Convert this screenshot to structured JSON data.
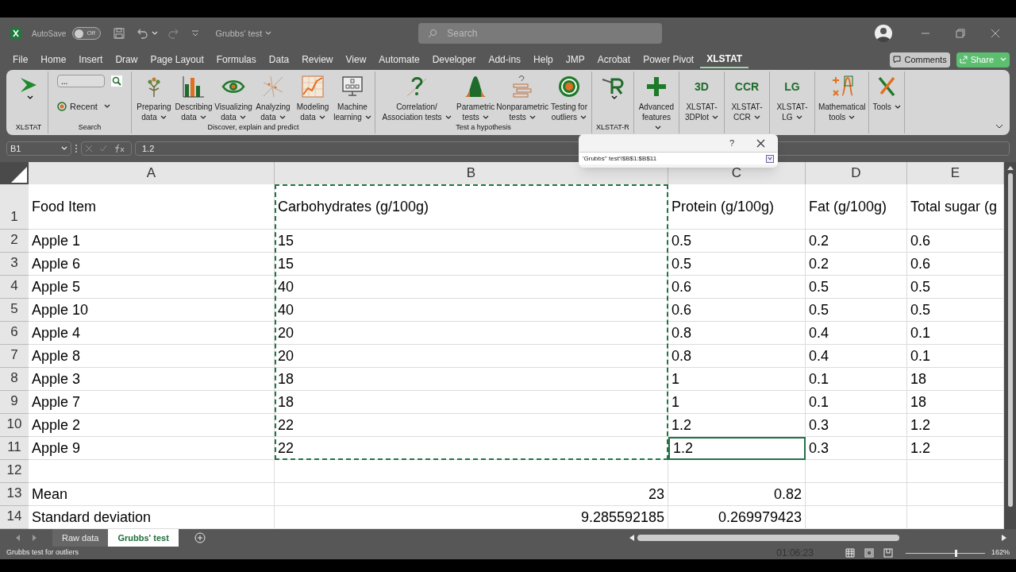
{
  "title_bar": {
    "autosave_label": "AutoSave",
    "autosave_on": false,
    "toggle_label": "Off",
    "document_title": "Grubbs' test",
    "search_placeholder": "Search"
  },
  "menu_tabs": [
    {
      "label": "File",
      "selected": false
    },
    {
      "label": "Home",
      "selected": false
    },
    {
      "label": "Insert",
      "selected": false
    },
    {
      "label": "Draw",
      "selected": false
    },
    {
      "label": "Page Layout",
      "selected": false
    },
    {
      "label": "Formulas",
      "selected": false
    },
    {
      "label": "Data",
      "selected": false
    },
    {
      "label": "Review",
      "selected": false
    },
    {
      "label": "View",
      "selected": false
    },
    {
      "label": "Automate",
      "selected": false
    },
    {
      "label": "Developer",
      "selected": false
    },
    {
      "label": "Add-ins",
      "selected": false
    },
    {
      "label": "Help",
      "selected": false
    },
    {
      "label": "JMP",
      "selected": false
    },
    {
      "label": "Acrobat",
      "selected": false
    },
    {
      "label": "Power Pivot",
      "selected": false
    },
    {
      "label": "XLSTAT",
      "selected": true
    }
  ],
  "comments_label": "Comments",
  "share_label": "Share",
  "ribbon_groups": [
    {
      "label": "XLSTAT",
      "kind": "launcher"
    },
    {
      "label": "Search",
      "kind": "search",
      "field_value": "...",
      "recent_label": "Recent"
    },
    {
      "label": "Discover, explain and predict",
      "kind": "buttons",
      "buttons": [
        {
          "label": "Preparing data"
        },
        {
          "label": "Describing data"
        },
        {
          "label": "Visualizing data"
        },
        {
          "label": "Analyzing data"
        },
        {
          "label": "Modeling data"
        },
        {
          "label": "Machine learning"
        }
      ]
    },
    {
      "label": "Test a hypothesis",
      "kind": "buttons",
      "buttons": [
        {
          "label": "Correlation/ Association tests"
        },
        {
          "label": "Parametric tests"
        },
        {
          "label": "Nonparametric tests"
        },
        {
          "label": "Testing for outliers"
        }
      ]
    },
    {
      "label": "XLSTAT-R",
      "kind": "rlauncher"
    },
    {
      "kind": "buttons",
      "buttons": [
        {
          "label": "Advanced features"
        }
      ]
    },
    {
      "kind": "buttons",
      "buttons": [
        {
          "label": "XLSTAT-3DPlot",
          "icon_text": "3D"
        }
      ]
    },
    {
      "kind": "buttons",
      "buttons": [
        {
          "label": "XLSTAT- CCR",
          "icon_text": "CCR"
        }
      ]
    },
    {
      "kind": "buttons",
      "buttons": [
        {
          "label": "XLSTAT- LG",
          "icon_text": "LG"
        }
      ]
    },
    {
      "kind": "buttons",
      "buttons": [
        {
          "label": "Mathematical tools"
        }
      ]
    },
    {
      "kind": "buttons",
      "buttons": [
        {
          "label": "Tools"
        }
      ]
    }
  ],
  "formula_bar": {
    "name_box": "B1",
    "formula": "1.2"
  },
  "reference_dialog": {
    "help": "?",
    "reference": "'Grubbs'' test'!$B$1:$B$11"
  },
  "grid": {
    "columns": [
      {
        "letter": "A",
        "copied": false
      },
      {
        "letter": "B",
        "copied": true
      },
      {
        "letter": "C",
        "copied": false
      },
      {
        "letter": "D",
        "copied": false
      },
      {
        "letter": "E",
        "copied": false
      }
    ],
    "rows": [
      {
        "number": "1",
        "kind": "header",
        "cells": [
          {
            "text": "Food Item",
            "selected": false
          },
          {
            "text": "Carbohydrates (g/100g)",
            "selected": false
          },
          {
            "text": "Protein (g/100g)",
            "selected": false
          },
          {
            "text": "Fat (g/100g)",
            "selected": false
          },
          {
            "text": "Total sugar (g",
            "selected": false
          }
        ]
      },
      {
        "number": "2",
        "kind": "data",
        "cells": [
          {
            "text": "Apple 1",
            "selected": false
          },
          {
            "text": "15",
            "selected": false
          },
          {
            "text": "0.5",
            "selected": false
          },
          {
            "text": "0.2",
            "selected": false
          },
          {
            "text": "0.6",
            "selected": false
          }
        ]
      },
      {
        "number": "3",
        "kind": "data",
        "cells": [
          {
            "text": "Apple 6",
            "selected": false
          },
          {
            "text": "15",
            "selected": false
          },
          {
            "text": "0.5",
            "selected": false
          },
          {
            "text": "0.2",
            "selected": false
          },
          {
            "text": "0.6",
            "selected": false
          }
        ]
      },
      {
        "number": "4",
        "kind": "data",
        "cells": [
          {
            "text": "Apple 5",
            "selected": false
          },
          {
            "text": "40",
            "selected": false
          },
          {
            "text": "0.6",
            "selected": false
          },
          {
            "text": "0.5",
            "selected": false
          },
          {
            "text": "0.5",
            "selected": false
          }
        ]
      },
      {
        "number": "5",
        "kind": "data",
        "cells": [
          {
            "text": "Apple 10",
            "selected": false
          },
          {
            "text": "40",
            "selected": false
          },
          {
            "text": "0.6",
            "selected": false
          },
          {
            "text": "0.5",
            "selected": false
          },
          {
            "text": "0.5",
            "selected": false
          }
        ]
      },
      {
        "number": "6",
        "kind": "data",
        "cells": [
          {
            "text": "Apple 4",
            "selected": false
          },
          {
            "text": "20",
            "selected": false
          },
          {
            "text": "0.8",
            "selected": false
          },
          {
            "text": "0.4",
            "selected": false
          },
          {
            "text": "0.1",
            "selected": false
          }
        ]
      },
      {
        "number": "7",
        "kind": "data",
        "cells": [
          {
            "text": "Apple 8",
            "selected": false
          },
          {
            "text": "20",
            "selected": false
          },
          {
            "text": "0.8",
            "selected": false
          },
          {
            "text": "0.4",
            "selected": false
          },
          {
            "text": "0.1",
            "selected": false
          }
        ]
      },
      {
        "number": "8",
        "kind": "data",
        "cells": [
          {
            "text": "Apple 3",
            "selected": false
          },
          {
            "text": "18",
            "selected": false
          },
          {
            "text": "1",
            "selected": false
          },
          {
            "text": "0.1",
            "selected": false
          },
          {
            "text": "18",
            "selected": false
          }
        ]
      },
      {
        "number": "9",
        "kind": "data",
        "cells": [
          {
            "text": "Apple 7",
            "selected": false
          },
          {
            "text": "18",
            "selected": false
          },
          {
            "text": "1",
            "selected": false
          },
          {
            "text": "0.1",
            "selected": false
          },
          {
            "text": "18",
            "selected": false
          }
        ]
      },
      {
        "number": "10",
        "kind": "data",
        "cells": [
          {
            "text": "Apple 2",
            "selected": false
          },
          {
            "text": "22",
            "selected": false
          },
          {
            "text": "1.2",
            "selected": false
          },
          {
            "text": "0.3",
            "selected": false
          },
          {
            "text": "1.2",
            "selected": false
          }
        ]
      },
      {
        "number": "11",
        "kind": "data",
        "cells": [
          {
            "text": "Apple 9",
            "selected": false
          },
          {
            "text": "22",
            "selected": false
          },
          {
            "text": "1.2",
            "selected": true
          },
          {
            "text": "0.3",
            "selected": false
          },
          {
            "text": "1.2",
            "selected": false
          }
        ]
      },
      {
        "number": "12",
        "kind": "blank",
        "cells": [
          {
            "selected": false
          },
          {
            "selected": false
          },
          {
            "selected": false
          },
          {
            "selected": false
          },
          {
            "selected": false
          }
        ]
      },
      {
        "number": "13",
        "kind": "stat",
        "cells": [
          {
            "text": "Mean",
            "selected": false
          },
          {
            "text": "23",
            "selected": false
          },
          {
            "text": "0.82",
            "selected": false
          },
          {
            "selected": false
          },
          {
            "selected": false
          }
        ]
      },
      {
        "number": "14",
        "kind": "stat",
        "cells": [
          {
            "text": "Standard deviation",
            "selected": false
          },
          {
            "text": "9.285592185",
            "selected": false
          },
          {
            "text": "0.269979423",
            "selected": false
          },
          {
            "selected": false
          },
          {
            "selected": false
          }
        ]
      }
    ]
  },
  "sheet_tabs": [
    {
      "label": "Raw data",
      "selected": false
    },
    {
      "label": "Grubbs' test",
      "selected": true
    }
  ],
  "status_bar": {
    "message": "Grubbs test for outliers",
    "recording_time": "01:06:23",
    "zoom": "162%",
    "zoom_slider": {
      "level": 0.62
    }
  }
}
